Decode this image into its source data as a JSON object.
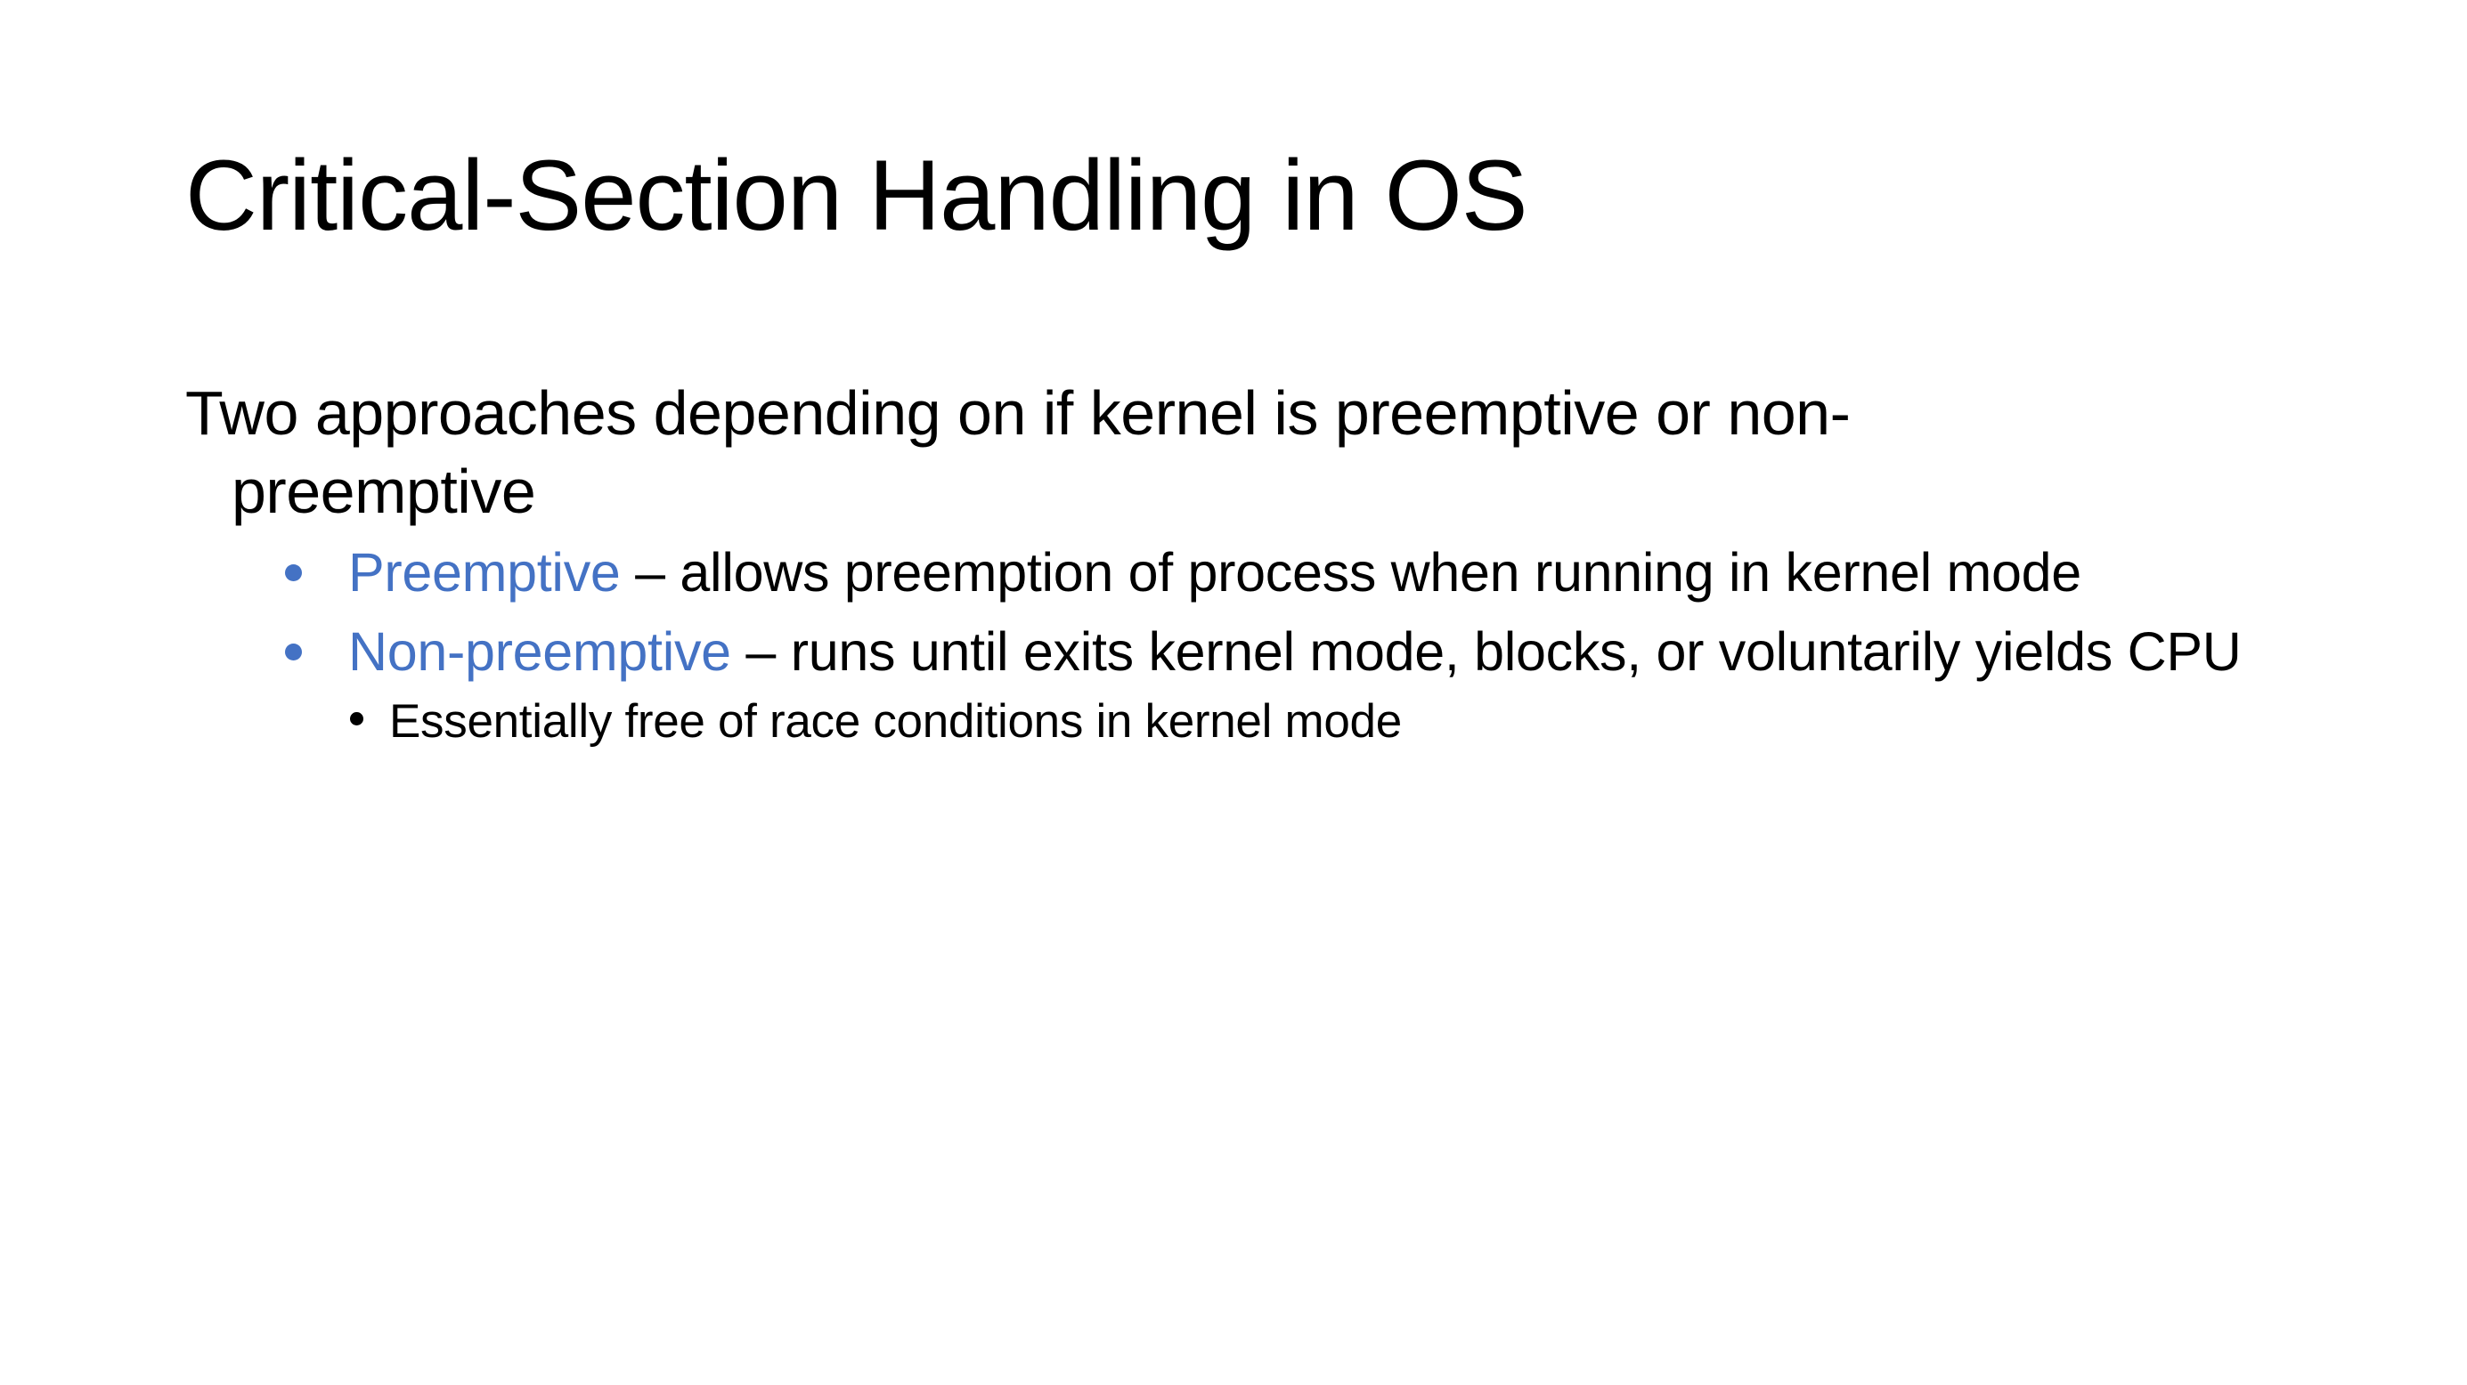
{
  "slide": {
    "title": "Critical-Section Handling in OS",
    "intro": "Two approaches depending on if kernel is preemptive or non-preemptive",
    "bullets": [
      {
        "term": "Preemptive",
        "text": " – allows preemption of process when running in kernel mode"
      },
      {
        "term": "Non-preemptive",
        "text": " – runs until exits kernel mode, blocks, or voluntarily yields CPU",
        "sub_bullets": [
          "Essentially free of race conditions in kernel mode"
        ]
      }
    ]
  },
  "colors": {
    "accent": "#4472C4",
    "text": "#000000",
    "background": "#FFFFFF"
  }
}
